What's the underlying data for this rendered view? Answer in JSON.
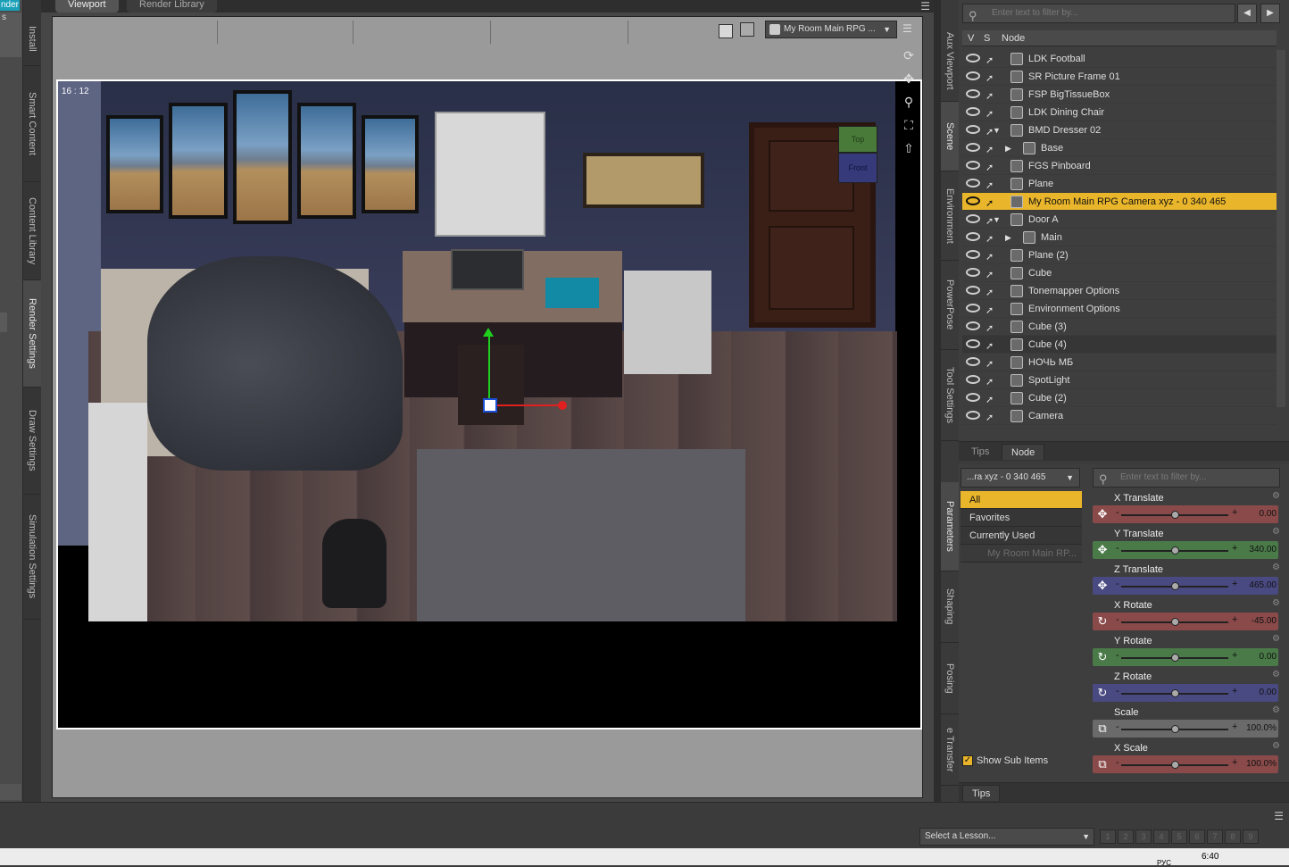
{
  "left_strip": {
    "top_tab": "nder",
    "second_tab": "s"
  },
  "left_vtabs": [
    "Install",
    "Smart Content",
    "Content Library",
    "Render Settings",
    "Draw Settings",
    "Simulation Settings"
  ],
  "viewport": {
    "tabs": [
      "Viewport",
      "Render Library"
    ],
    "active_tab": "Viewport",
    "camera_select": "My Room Main RPG ...",
    "aspect_label": "16 : 12",
    "nav_cube": {
      "top": "Top",
      "front": "Front"
    }
  },
  "right_vtabs_top": [
    "Aux Viewport",
    "Scene",
    "Environment",
    "PowerPose",
    "Tool Settings"
  ],
  "right_vtabs_bottom": [
    "Parameters",
    "Shaping",
    "Posing",
    "e Transfer"
  ],
  "scene": {
    "filter_placeholder": "Enter text to filter by...",
    "columns": {
      "v": "V",
      "s": "S",
      "node": "Node"
    },
    "rows": [
      {
        "label": "LDK Football",
        "icon": "figure-icon",
        "indent": 0
      },
      {
        "label": "SR Picture Frame 01",
        "icon": "figure-icon",
        "indent": 0
      },
      {
        "label": "FSP BigTissueBox",
        "icon": "figure-icon",
        "indent": 0
      },
      {
        "label": "LDK Dining Chair",
        "icon": "figure-icon",
        "indent": 0
      },
      {
        "label": "BMD Dresser 02",
        "icon": "group-icon",
        "indent": 0,
        "expanded": true
      },
      {
        "label": "Base",
        "icon": "bone-icon",
        "indent": 1,
        "collapsed": true
      },
      {
        "label": "FGS Pinboard",
        "icon": "figure-icon",
        "indent": 0
      },
      {
        "label": "Plane",
        "icon": "figure-icon",
        "indent": 0
      },
      {
        "label": "My Room Main RPG Camera xyz - 0 340 465",
        "icon": "camera-icon",
        "indent": 0,
        "selected": true
      },
      {
        "label": "Door A",
        "icon": "group-icon",
        "indent": 0,
        "expanded": true
      },
      {
        "label": "Main",
        "icon": "bone-icon",
        "indent": 1,
        "collapsed": true
      },
      {
        "label": "Plane (2)",
        "icon": "figure-icon",
        "indent": 0
      },
      {
        "label": "Cube",
        "icon": "figure-icon",
        "indent": 0
      },
      {
        "label": "Tonemapper Options",
        "icon": "render-icon",
        "indent": 0
      },
      {
        "label": "Environment Options",
        "icon": "environment-icon",
        "indent": 0
      },
      {
        "label": "Cube (3)",
        "icon": "figure-icon",
        "indent": 0
      },
      {
        "label": "Cube (4)",
        "icon": "figure-icon",
        "indent": 0,
        "alt": true
      },
      {
        "label": "НОЧЬ МБ",
        "icon": "light-icon",
        "indent": 0
      },
      {
        "label": "SpotLight",
        "icon": "spotlight-icon",
        "indent": 0
      },
      {
        "label": "Cube (2)",
        "icon": "figure-icon",
        "indent": 0
      },
      {
        "label": "Camera",
        "icon": "camera-icon",
        "indent": 0
      }
    ],
    "bottom_tabs": [
      "Tips",
      "Node"
    ],
    "active_bottom_tab": "Node"
  },
  "parameters": {
    "node_select": "...ra xyz - 0 340 465",
    "filter_placeholder": "Enter text to filter by...",
    "categories": [
      {
        "label": "All",
        "selected": true
      },
      {
        "label": "Favorites"
      },
      {
        "label": "Currently Used"
      },
      {
        "label": "My Room Main RP...",
        "grey": true
      }
    ],
    "show_sub_items": "Show Sub Items",
    "sliders": [
      {
        "name": "X Translate",
        "value": "0.00",
        "color": "#8a4a4a",
        "icon": "translate-icon",
        "pos": 0.5
      },
      {
        "name": "Y Translate",
        "value": "340.00",
        "color": "#4a7a48",
        "icon": "translate-icon",
        "pos": 0.5
      },
      {
        "name": "Z Translate",
        "value": "465.00",
        "color": "#4a4a82",
        "icon": "translate-icon",
        "pos": 0.5
      },
      {
        "name": "X Rotate",
        "value": "-45.00",
        "color": "#8a4a4a",
        "icon": "rotate-icon",
        "pos": 0.5
      },
      {
        "name": "Y Rotate",
        "value": "0.00",
        "color": "#4a7a48",
        "icon": "rotate-icon",
        "pos": 0.5
      },
      {
        "name": "Z Rotate",
        "value": "0.00",
        "color": "#4a4a82",
        "icon": "rotate-icon",
        "pos": 0.5
      },
      {
        "name": "Scale",
        "value": "100.0%",
        "color": "#6a6a6a",
        "icon": "scale-icon",
        "pos": 0.5
      },
      {
        "name": "X Scale",
        "value": "100.0%",
        "color": "#8a4a4a",
        "icon": "scale-icon",
        "pos": 0.5
      }
    ],
    "tips_tab": "Tips"
  },
  "bottom": {
    "lesson_select": "Select a Lesson...",
    "steps": [
      "1",
      "2",
      "3",
      "4",
      "5",
      "6",
      "7",
      "8",
      "9"
    ]
  },
  "taskbar": {
    "time": "6:40",
    "lang": "РУС"
  },
  "colors": {
    "accent": "#e9b52a",
    "panel": "#3e3e3e",
    "teal_tab": "#1aa0b8"
  }
}
